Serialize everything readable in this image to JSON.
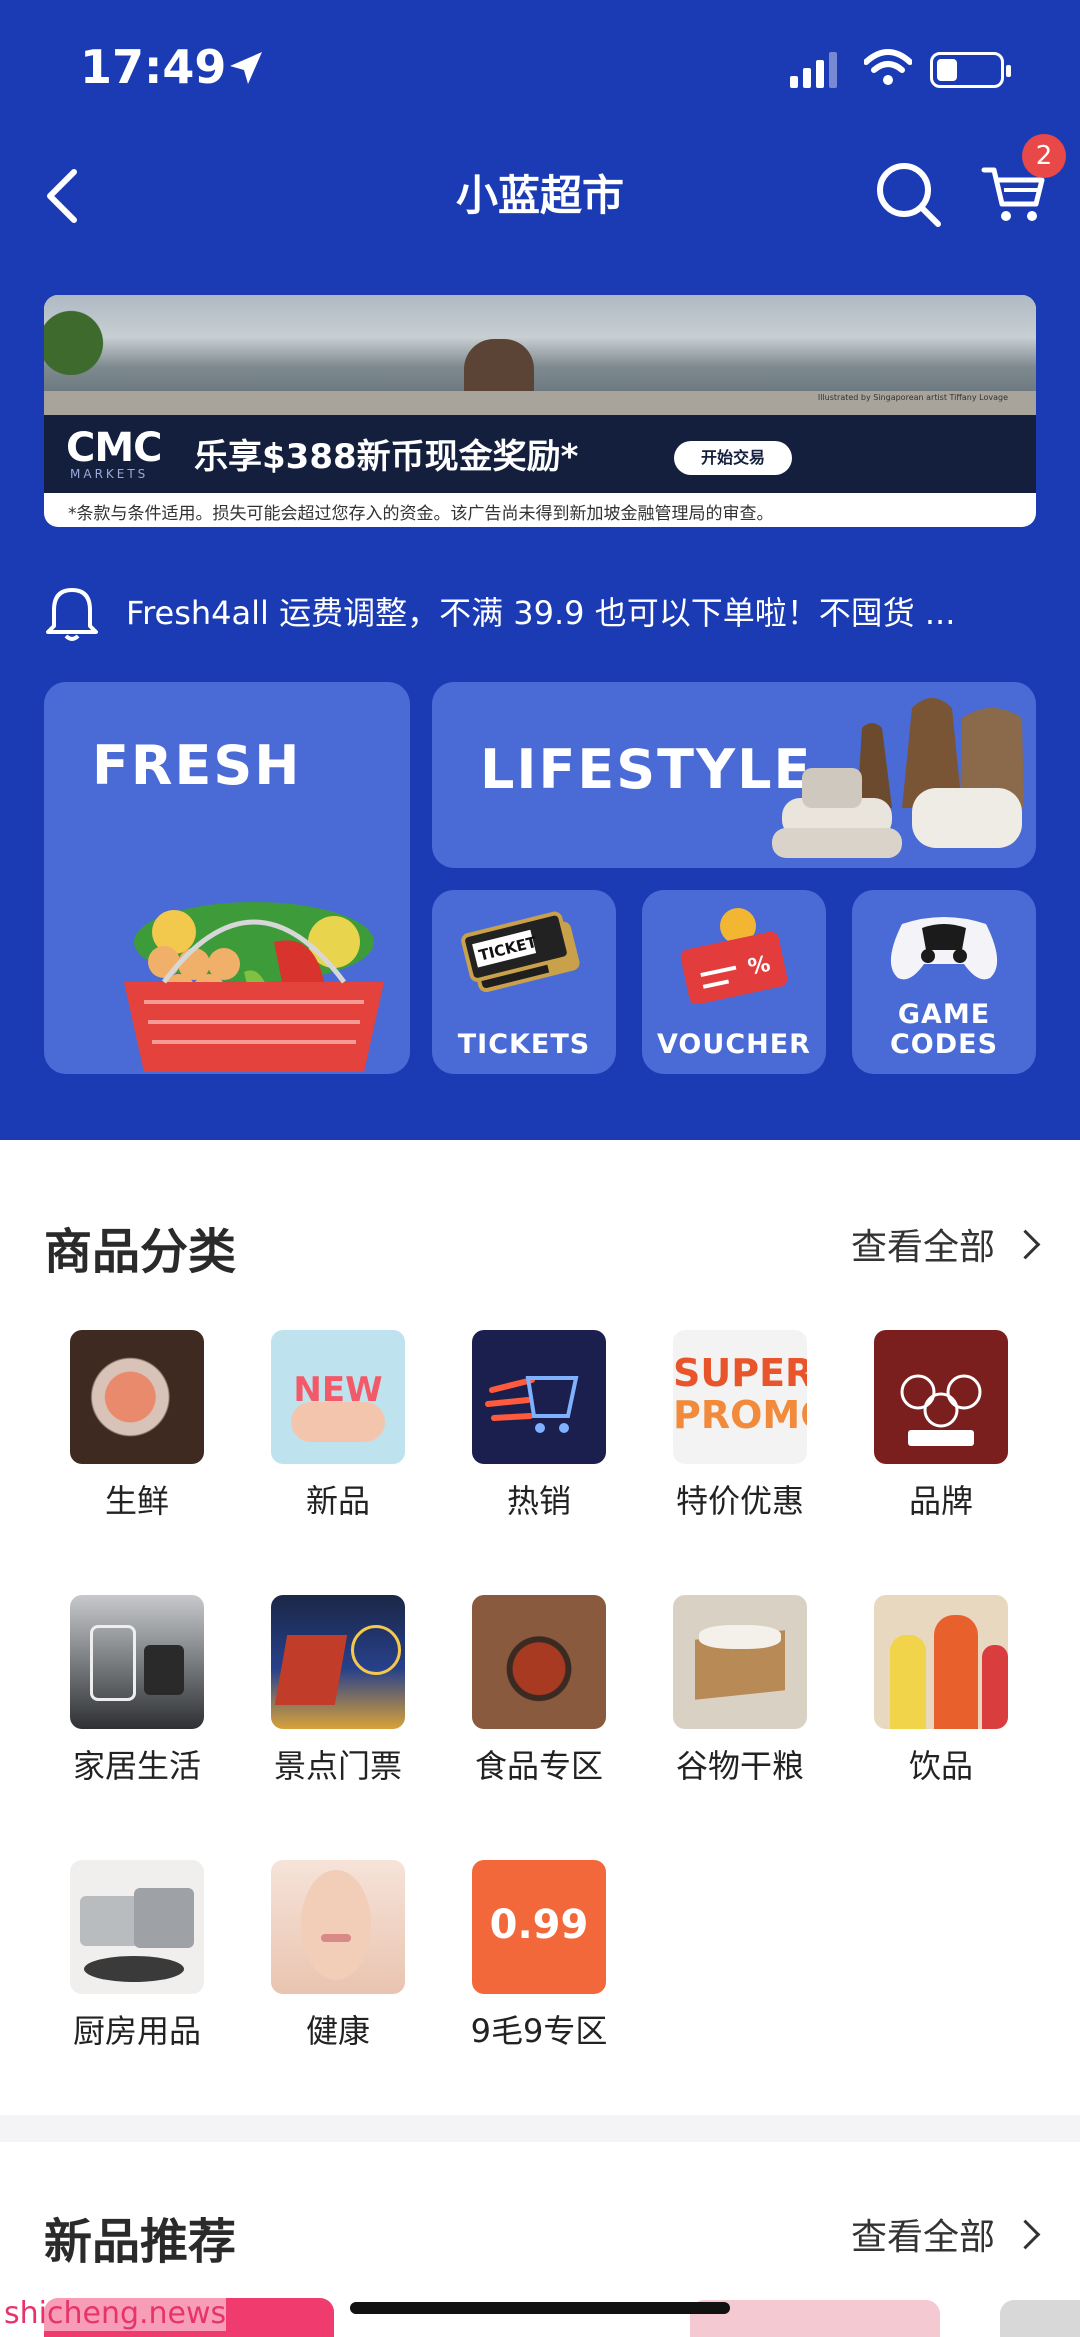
{
  "status_bar": {
    "time": "17:49"
  },
  "nav": {
    "title": "小蓝超市",
    "cart_count": "2"
  },
  "ad": {
    "logo": "CMC",
    "logo_sub": "MARKETS",
    "headline": "乐享$388新币现金奖励*",
    "cta": "开始交易",
    "credit": "Illustrated by Singaporean artist Tiffany Lovage",
    "disclaimer": "*条款与条件适用。损失可能会超过您存入的资金。该广告尚未得到新加坡金融管理局的审查。"
  },
  "notice": {
    "text": "Fresh4all 运费调整，不满 39.9 也可以下单啦！不囤货 ..."
  },
  "tiles": {
    "fresh": "FRESH",
    "lifestyle": "LIFESTYLE",
    "tickets": "TICKETS",
    "voucher": "VOUCHER",
    "game_codes": "GAME CODES"
  },
  "categories_section": {
    "title": "商品分类",
    "see_all": "查看全部",
    "items": [
      {
        "label": "生鲜",
        "icon": "fresh-meat-icon",
        "color": "#5a3a2e"
      },
      {
        "label": "新品",
        "icon": "new-badge-icon",
        "color": "#bfe3ee"
      },
      {
        "label": "热销",
        "icon": "hot-cart-icon",
        "color": "#1b1f4e"
      },
      {
        "label": "特价优惠",
        "icon": "super-promo-icon",
        "color": "#f3f3f3"
      },
      {
        "label": "品牌",
        "icon": "three-squirrels-icon",
        "color": "#7b1e1e"
      },
      {
        "label": "家居生活",
        "icon": "home-living-icon",
        "color": "#3a3d40"
      },
      {
        "label": "景点门票",
        "icon": "attraction-icon",
        "color": "#1a2747"
      },
      {
        "label": "食品专区",
        "icon": "food-hotpot-icon",
        "color": "#6d3a27"
      },
      {
        "label": "谷物干粮",
        "icon": "grain-rice-icon",
        "color": "#d9d1c4"
      },
      {
        "label": "饮品",
        "icon": "drinks-icon",
        "color": "#e08a3a"
      },
      {
        "label": "厨房用品",
        "icon": "cookware-icon",
        "color": "#c9c9c9"
      },
      {
        "label": "健康",
        "icon": "health-face-icon",
        "color": "#f1d4c6"
      },
      {
        "label": "9毛9专区",
        "icon": "price-099-icon",
        "color": "#f2683a",
        "badge": "0.99"
      }
    ]
  },
  "new_section": {
    "title": "新品推荐",
    "see_all": "查看全部"
  },
  "watermark": "shicheng.news"
}
